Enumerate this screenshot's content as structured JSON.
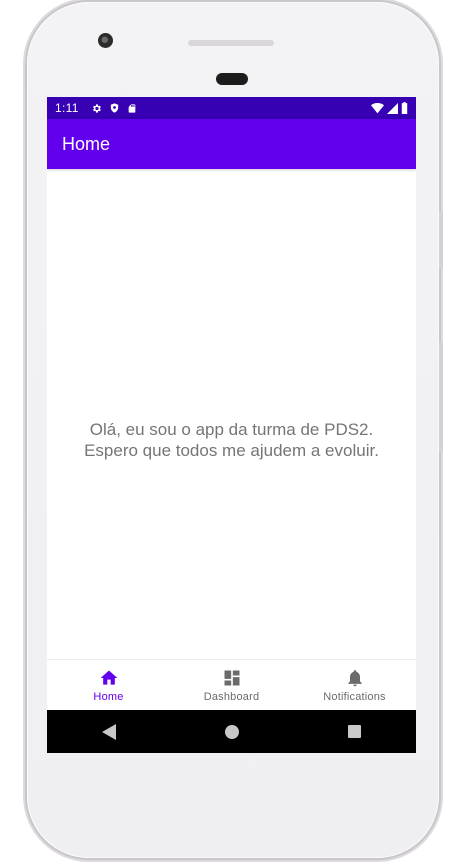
{
  "status_bar": {
    "time": "1:11",
    "left_icons": [
      "settings-icon",
      "shield-icon",
      "sd-card-icon"
    ],
    "right_icons": [
      "wifi-icon",
      "cell-signal-icon",
      "battery-icon"
    ]
  },
  "app_bar": {
    "title": "Home"
  },
  "content": {
    "message": "Olá, eu sou o app da turma de PDS2. Espero que todos me ajudem a evoluir."
  },
  "bottom_nav": {
    "items": [
      {
        "label": "Home",
        "icon": "home-icon",
        "active": true
      },
      {
        "label": "Dashboard",
        "icon": "dashboard-icon",
        "active": false
      },
      {
        "label": "Notifications",
        "icon": "bell-icon",
        "active": false
      }
    ]
  },
  "system_nav": {
    "buttons": [
      "back-icon",
      "home-circle-icon",
      "recents-icon"
    ]
  },
  "colors": {
    "status_bar": "#3700b3",
    "app_bar": "#6200ee",
    "accent": "#6200ee",
    "text": "#757575"
  }
}
